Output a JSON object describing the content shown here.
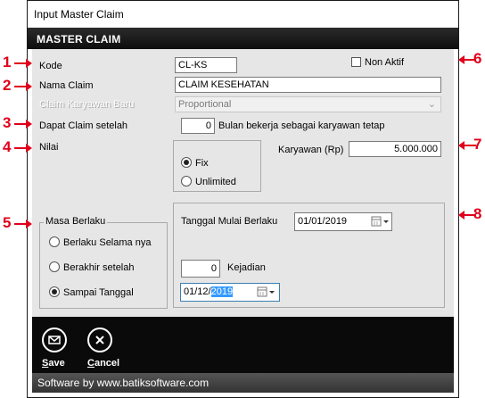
{
  "window": {
    "title": "Input Master Claim"
  },
  "header": {
    "title": "MASTER CLAIM"
  },
  "form": {
    "kode": {
      "label": "Kode",
      "value": "CL-KS"
    },
    "non_aktif": {
      "label": "Non Aktif",
      "checked": false
    },
    "nama_claim": {
      "label": "Nama Claim",
      "value": "CLAIM KESEHATAN"
    },
    "claim_karyawan_baru": {
      "label": "Claim Karyawan Baru",
      "value": "Proportional"
    },
    "dapat_claim": {
      "label": "Dapat Claim setelah",
      "value": "0",
      "suffix": "Bulan bekerja sebagai karyawan tetap"
    },
    "nilai": {
      "label": "Nilai",
      "options": [
        "Fix",
        "Unlimited"
      ],
      "selected": "Fix"
    },
    "karyawan": {
      "label": "Karyawan (Rp)",
      "value": "5.000.000"
    },
    "masa_berlaku": {
      "title": "Masa Berlaku",
      "options": [
        "Berlaku Selama nya",
        "Berakhir setelah",
        "Sampai Tanggal"
      ],
      "selected": "Sampai Tanggal"
    },
    "tanggal_mulai": {
      "label": "Tanggal Mulai Berlaku",
      "value": "01/01/2019"
    },
    "kejadian": {
      "value": "0",
      "label": "Kejadian"
    },
    "sampai_tanggal": {
      "value_prefix": "01/12/",
      "value_selected": "2019"
    }
  },
  "toolbar": {
    "save_label": "Save",
    "save_key": "S",
    "save_rest": "ave",
    "cancel_label": "Cancel",
    "cancel_key": "C",
    "cancel_rest": "ancel"
  },
  "footer": {
    "text": "Software by www.batiksoftware.com"
  },
  "callouts": [
    "1",
    "2",
    "3",
    "4",
    "5",
    "6",
    "7",
    "8"
  ],
  "colors": {
    "callout": "#e0001b",
    "header_bg": "#1a1a1a",
    "panel_bg": "#e6e6e6",
    "selection": "#3399ff"
  }
}
